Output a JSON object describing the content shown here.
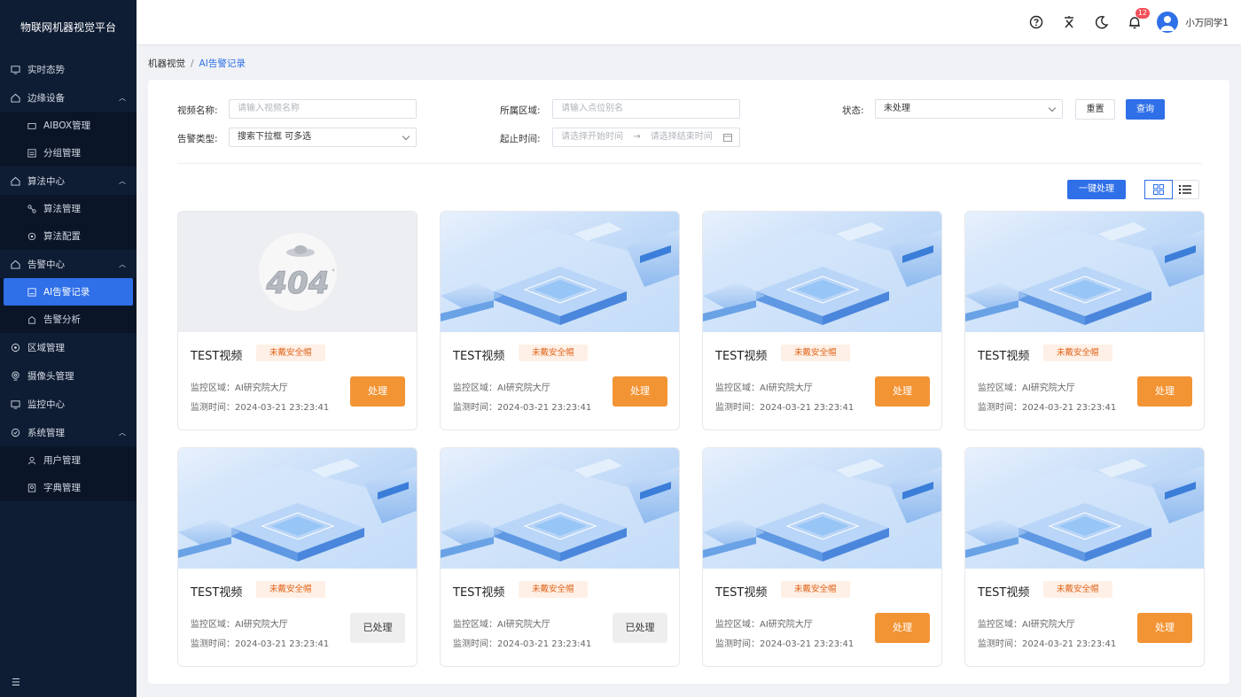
{
  "app": {
    "title": "物联网机器视觉平台"
  },
  "sidebar": {
    "items": [
      {
        "label": "实时态势",
        "icon": "monitor-icon"
      },
      {
        "label": "边缘设备",
        "icon": "home-icon",
        "children": [
          {
            "label": "AIBOX管理",
            "icon": "box-icon"
          },
          {
            "label": "分组管理",
            "icon": "group-icon"
          }
        ]
      },
      {
        "label": "算法中心",
        "icon": "home-icon",
        "children": [
          {
            "label": "算法管理",
            "icon": "flow-icon"
          },
          {
            "label": "算法配置",
            "icon": "config-icon"
          }
        ]
      },
      {
        "label": "告警中心",
        "icon": "home-icon",
        "children": [
          {
            "label": "AI告警记录",
            "icon": "alert-record-icon"
          },
          {
            "label": "告警分析",
            "icon": "analysis-icon"
          }
        ]
      },
      {
        "label": "区域管理",
        "icon": "region-icon"
      },
      {
        "label": "摄像头管理",
        "icon": "camera-icon"
      },
      {
        "label": "监控中心",
        "icon": "monitor-icon"
      },
      {
        "label": "系统管理",
        "icon": "system-icon",
        "children": [
          {
            "label": "用户管理",
            "icon": "user-icon"
          },
          {
            "label": "字典管理",
            "icon": "dictionary-icon"
          }
        ]
      }
    ]
  },
  "header": {
    "notification_count": "12",
    "user_name": "小万同学1"
  },
  "breadcrumb": {
    "parent": "机器视觉",
    "separator": "/",
    "current": "AI告警记录"
  },
  "filters": {
    "video_name": {
      "label": "视频名称:",
      "placeholder": "请输入视频名称"
    },
    "region": {
      "label": "所属区域:",
      "placeholder": "请输入点位别名"
    },
    "status": {
      "label": "状态:",
      "value": "未处理"
    },
    "alarm_type": {
      "label": "告警类型:",
      "value": "搜索下拉框 可多选"
    },
    "time_range": {
      "label": "起止时间:",
      "start_placeholder": "请选择开始时间",
      "end_placeholder": "请选择结束时间",
      "arrow": "→"
    },
    "reset_label": "重置",
    "query_label": "查询"
  },
  "toolbar": {
    "batch_label": "一键处理"
  },
  "cards": [
    {
      "title": "TEST视频",
      "tag": "未戴安全帽",
      "region": "监控区域：AI研究院大厅",
      "time": "监测时间：2024-03-21 23:23:41",
      "action": "处理",
      "image": "404",
      "image_text": "404"
    },
    {
      "title": "TEST视频",
      "tag": "未戴安全帽",
      "region": "监控区域：AI研究院大厅",
      "time": "监测时间：2024-03-21 23:23:41",
      "action": "处理",
      "image": "scene"
    },
    {
      "title": "TEST视频",
      "tag": "未戴安全帽",
      "region": "监控区域：AI研究院大厅",
      "time": "监测时间：2024-03-21 23:23:41",
      "action": "处理",
      "image": "scene"
    },
    {
      "title": "TEST视频",
      "tag": "未戴安全帽",
      "region": "监控区域：AI研究院大厅",
      "time": "监测时间：2024-03-21 23:23:41",
      "action": "处理",
      "image": "scene"
    },
    {
      "title": "TEST视频",
      "tag": "未戴安全帽",
      "region": "监控区域：AI研究院大厅",
      "time": "监测时间：2024-03-21 23:23:41",
      "action": "已处理",
      "image": "scene"
    },
    {
      "title": "TEST视频",
      "tag": "未戴安全帽",
      "region": "监控区域：AI研究院大厅",
      "time": "监测时间：2024-03-21 23:23:41",
      "action": "已处理",
      "image": "scene"
    },
    {
      "title": "TEST视频",
      "tag": "未戴安全帽",
      "region": "监控区域：AI研究院大厅",
      "time": "监测时间：2024-03-21 23:23:41",
      "action": "处理",
      "image": "scene"
    },
    {
      "title": "TEST视频",
      "tag": "未戴安全帽",
      "region": "监控区域：AI研究院大厅",
      "time": "监测时间：2024-03-21 23:23:41",
      "action": "处理",
      "image": "scene"
    }
  ],
  "colors": {
    "primary": "#2f6fe8",
    "sidebar_bg": "#0f1d34",
    "warning": "#f39434",
    "tag_bg": "#fef0e6",
    "tag_text": "#e0641a"
  }
}
